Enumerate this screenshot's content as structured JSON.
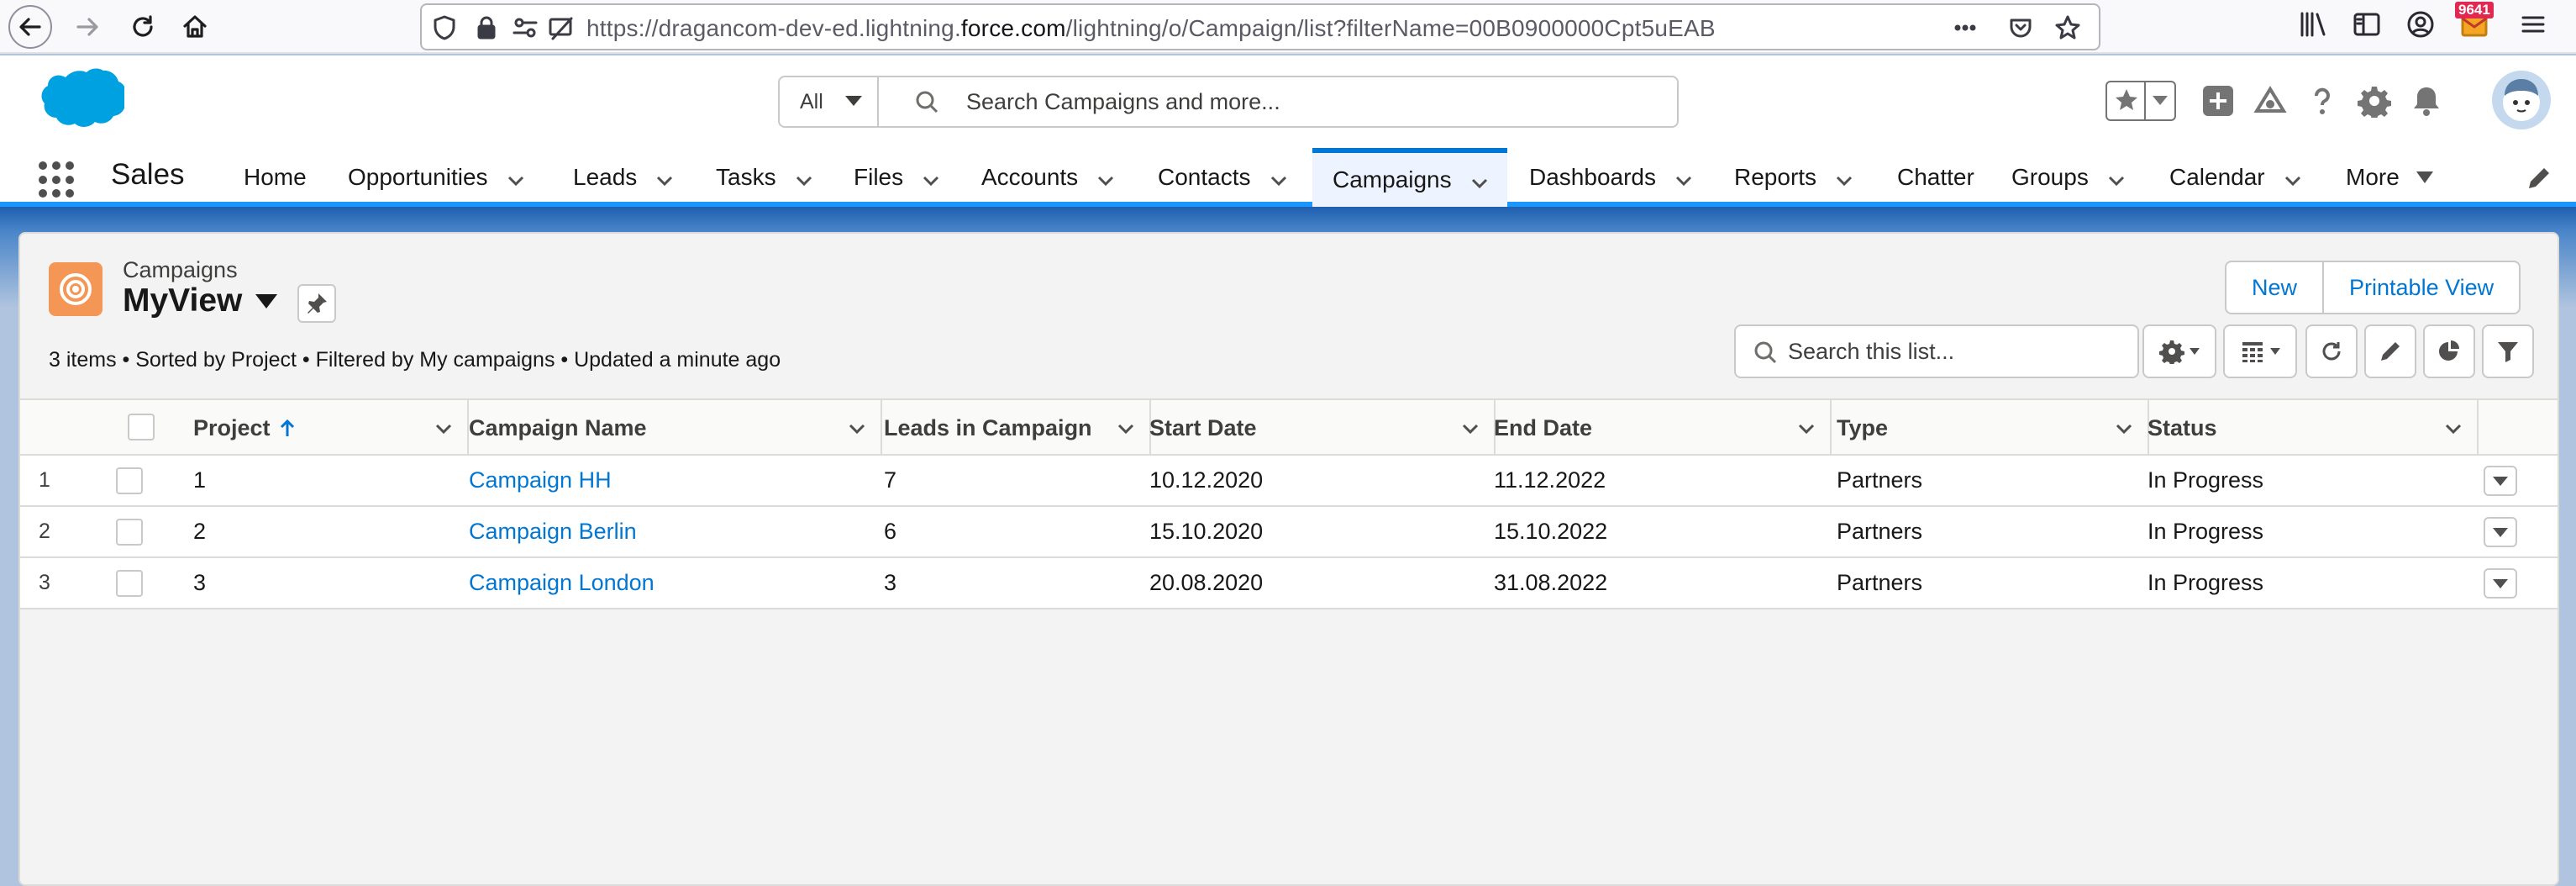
{
  "browser": {
    "url_prefix": "https://dragancom-dev-ed.lightning.",
    "url_domain": "force.com",
    "url_suffix": "/lightning/o/Campaign/list?filterName=00B0900000Cpt5uEAB",
    "mail_badge": "9641"
  },
  "header": {
    "search_scope": "All",
    "search_placeholder": "Search Campaigns and more..."
  },
  "nav": {
    "app_name": "Sales",
    "items": [
      {
        "label": "Home"
      },
      {
        "label": "Opportunities"
      },
      {
        "label": "Leads"
      },
      {
        "label": "Tasks"
      },
      {
        "label": "Files"
      },
      {
        "label": "Accounts"
      },
      {
        "label": "Contacts"
      },
      {
        "label": "Campaigns"
      },
      {
        "label": "Dashboards"
      },
      {
        "label": "Reports"
      },
      {
        "label": "Chatter"
      },
      {
        "label": "Groups"
      },
      {
        "label": "Calendar"
      },
      {
        "label": "More"
      }
    ]
  },
  "list": {
    "object_label": "Campaigns",
    "view_name": "MyView",
    "meta": "3 items • Sorted by Project • Filtered by My campaigns • Updated a minute ago",
    "buttons": {
      "new": "New",
      "printable": "Printable View"
    },
    "search_placeholder": "Search this list...",
    "columns": [
      "Project",
      "Campaign Name",
      "Leads in Campaign",
      "Start Date",
      "End Date",
      "Type",
      "Status"
    ],
    "rows": [
      {
        "num": "1",
        "project": "1",
        "name": "Campaign HH",
        "leads": "7",
        "start": "10.12.2020",
        "end": "11.12.2022",
        "type": "Partners",
        "status": "In Progress"
      },
      {
        "num": "2",
        "project": "2",
        "name": "Campaign Berlin",
        "leads": "6",
        "start": "15.10.2020",
        "end": "15.10.2022",
        "type": "Partners",
        "status": "In Progress"
      },
      {
        "num": "3",
        "project": "3",
        "name": "Campaign London",
        "leads": "3",
        "start": "20.08.2020",
        "end": "31.08.2022",
        "type": "Partners",
        "status": "In Progress"
      }
    ]
  },
  "colors": {
    "brand": "#0176d3",
    "campaign_icon": "#f49756"
  }
}
